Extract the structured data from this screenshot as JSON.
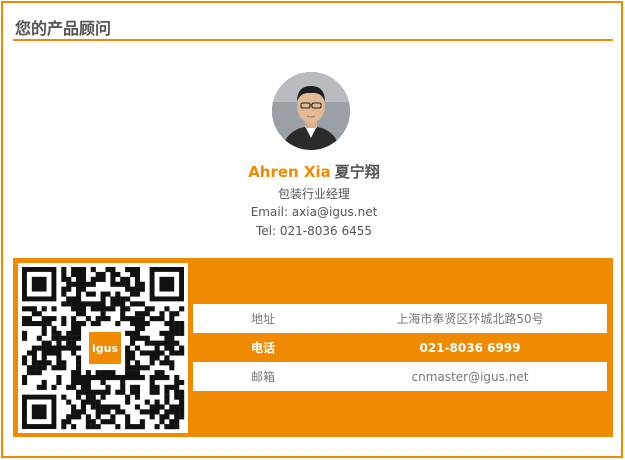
{
  "header": {
    "title": "您的产品顾问"
  },
  "advisor": {
    "name_en": "Ahren Xia",
    "name_cn": "夏宁翔",
    "role": "包装行业经理",
    "email": "Email: axia@igus.net",
    "tel": "Tel: 021-8036 6455"
  },
  "qr": {
    "logo_text": "igus"
  },
  "contact": {
    "rows": [
      {
        "label": "地址",
        "value": "上海市奉贤区环城北路50号"
      },
      {
        "label": "电话",
        "value": "021-8036 6999"
      },
      {
        "label": "邮箱",
        "value": "cnmaster@igus.net"
      }
    ]
  },
  "colors": {
    "accent": "#f08a00",
    "text": "#555555"
  }
}
